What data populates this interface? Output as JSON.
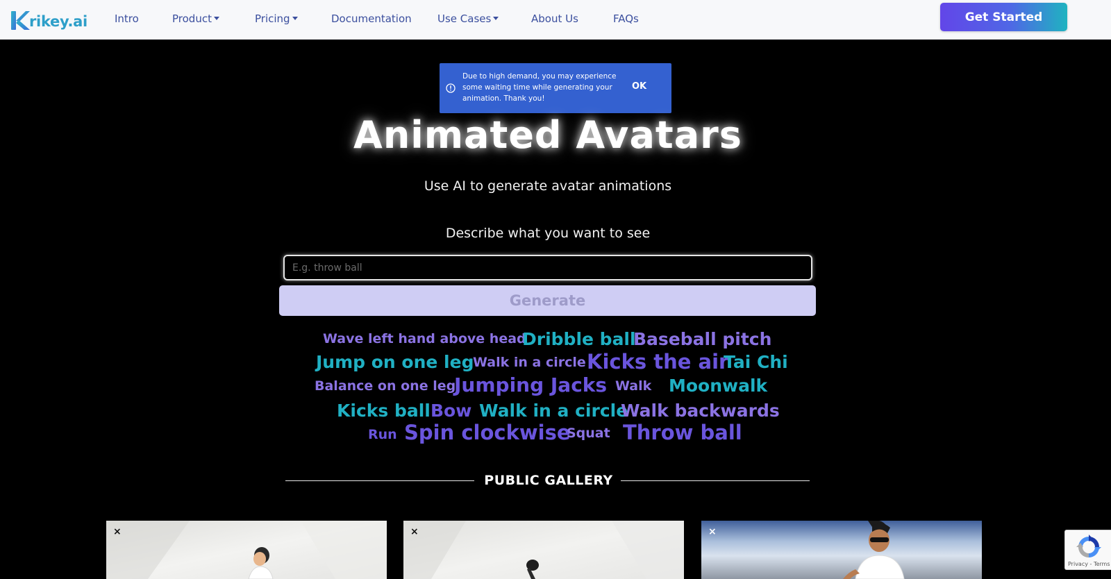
{
  "nav": {
    "logo_initial": "K",
    "logo_text": "rikey.ai",
    "items": [
      {
        "label": "Intro",
        "dropdown": false
      },
      {
        "label": "Product",
        "dropdown": true
      },
      {
        "label": "Pricing",
        "dropdown": true
      },
      {
        "label": "Documentation",
        "dropdown": false
      },
      {
        "label": "Use Cases",
        "dropdown": true
      },
      {
        "label": "About Us",
        "dropdown": false
      },
      {
        "label": "FAQs",
        "dropdown": false
      }
    ],
    "cta_label": "Get Started"
  },
  "alert": {
    "message": "Due to high demand, you may experience some waiting time while generating your animation. Thank you!",
    "ok_label": "OK"
  },
  "hero": {
    "title": "Animated Avatars",
    "subtitle": "Use AI to generate avatar animations",
    "prompt_label": "Describe what you want to see",
    "prompt_placeholder": "E.g. throw ball",
    "prompt_value": "",
    "generate_label": "Generate"
  },
  "suggestions": [
    "Wave left hand above head",
    "Dribble ball",
    "Baseball pitch",
    "Jump on one leg",
    "Walk in a circle",
    "Kicks the air",
    "Tai Chi",
    "Balance on one leg",
    "Jumping Jacks",
    "Walk",
    "Moonwalk",
    "Kicks ball",
    "Bow",
    "Walk in a circle",
    "Walk backwards",
    "Run",
    "Spin clockwise",
    "Squat",
    "Throw ball"
  ],
  "gallery": {
    "title": "PUBLIC GALLERY",
    "close_symbol": "×"
  },
  "recaptcha": {
    "links": "Privacy - Terms"
  }
}
